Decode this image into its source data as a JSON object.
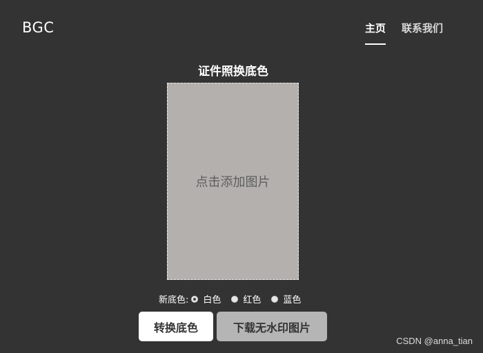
{
  "header": {
    "logo": "BGC",
    "nav": [
      {
        "label": "主页",
        "active": true
      },
      {
        "label": "联系我们",
        "active": false
      }
    ]
  },
  "main": {
    "title": "证件照换底色",
    "upload_placeholder": "点击添加图片",
    "color_label": "新底色:",
    "color_options": [
      {
        "label": "白色",
        "checked": true
      },
      {
        "label": "红色",
        "checked": false
      },
      {
        "label": "蓝色",
        "checked": false
      }
    ],
    "convert_button": "转换底色",
    "download_button": "下载无水印图片"
  },
  "watermark": "CSDN @anna_tian",
  "colors": {
    "background": "#333333",
    "upload_area": "#b3b0ae",
    "convert_button_bg": "#ffffff",
    "download_button_bg": "#b5b5b5"
  }
}
